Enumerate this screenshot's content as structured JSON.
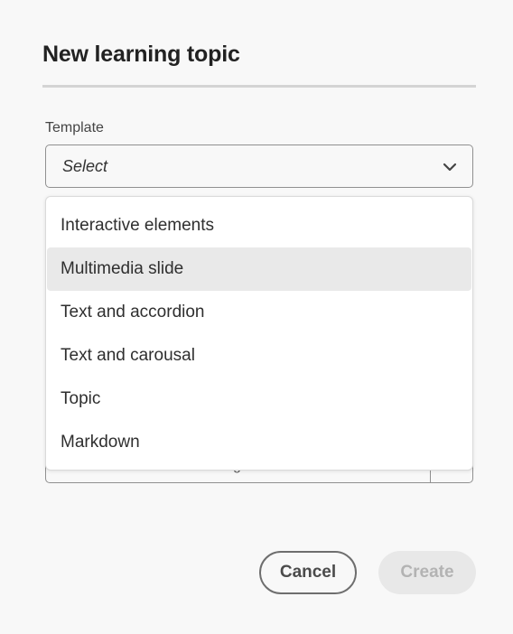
{
  "dialog": {
    "title": "New learning topic"
  },
  "template": {
    "label": "Template",
    "value": "Select",
    "options": [
      "Interactive elements",
      "Multimedia slide",
      "Text and accordion",
      "Text and carousal",
      "Topic",
      "Markdown"
    ],
    "highlighted_index": 1
  },
  "obscured_field": {
    "visible_fragment": "g"
  },
  "buttons": {
    "cancel": "Cancel",
    "create": "Create"
  },
  "colors": {
    "background": "#f8f8f8",
    "highlight": "#e9e9e9",
    "disabled_button": "#e8e8e8"
  },
  "icons": {
    "picker": "chevron-down-icon"
  }
}
